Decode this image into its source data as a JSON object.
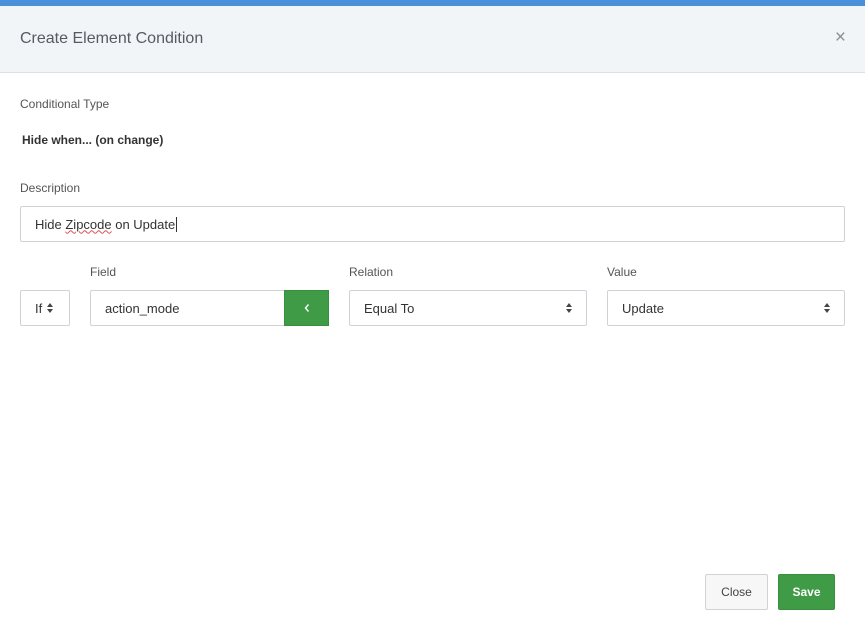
{
  "modal": {
    "title": "Create Element Condition",
    "close_glyph": "×"
  },
  "form": {
    "conditional_type_label": "Conditional Type",
    "conditional_type_value": "Hide when... (on change)",
    "description_label": "Description",
    "description_value_part1": "Hide ",
    "description_value_misspelled": "Zipcode",
    "description_value_part2": " on Update",
    "if_select_value": "If",
    "field_label": "Field",
    "field_value": "action_mode",
    "field_button_icon": "chevron-left-icon",
    "relation_label": "Relation",
    "relation_value": "Equal To",
    "value_label": "Value",
    "value_value": "Update"
  },
  "footer": {
    "close_label": "Close",
    "save_label": "Save"
  },
  "colors": {
    "accent_blue": "#4a90d9",
    "green": "#3f9b45"
  }
}
